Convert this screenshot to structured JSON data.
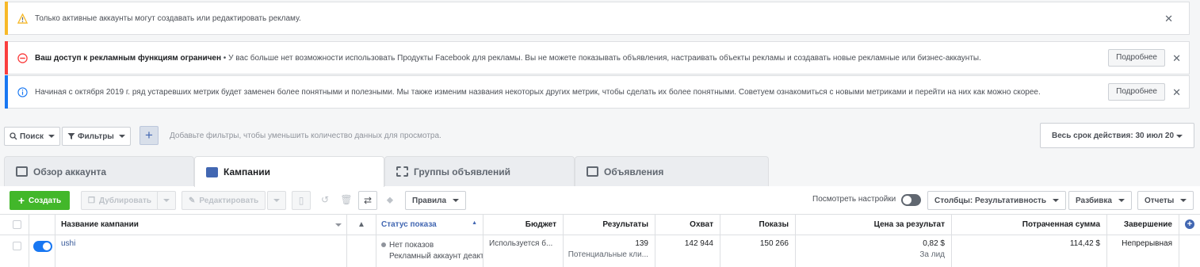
{
  "notices": {
    "inactive": {
      "text": "Только активные аккаунты могут создавать или редактировать рекламу."
    },
    "restricted": {
      "title": "Ваш доступ к рекламным функциям ограничен",
      "text": " • У вас больше нет возможности использовать Продукты Facebook для рекламы. Вы не можете показывать объявления, настраивать объекты рекламы и создавать новые рекламные или бизнес-аккаунты.",
      "button": "Подробнее"
    },
    "metrics": {
      "text": "Начиная с октября 2019 г. ряд устаревших метрик будет заменен более понятными и полезными. Мы также изменим названия некоторых других метрик, чтобы сделать их более понятными. Советуем ознакомиться с новыми метриками и перейти на них как можно скорее.",
      "button": "Подробнее"
    },
    "close": "✕"
  },
  "filterbar": {
    "search": "Поиск",
    "filters": "Фильтры",
    "hint": "Добавьте фильтры, чтобы уменьшить количество данных для просмотра.",
    "date_range": "Весь срок действия: 30 июл 20"
  },
  "tabs": [
    {
      "label": "Обзор аккаунта"
    },
    {
      "label": "Кампании"
    },
    {
      "label": "Группы объявлений"
    },
    {
      "label": "Объявления"
    }
  ],
  "toolbar": {
    "create": "Создать",
    "duplicate": "Дублировать",
    "edit": "Редактировать",
    "rules": "Правила",
    "view_settings": "Посмотреть настройки",
    "columns": "Столбцы: Результативность",
    "breakdown": "Разбивка",
    "reports": "Отчеты"
  },
  "table": {
    "headers": {
      "name": "Название кампании",
      "status": "Статус показа",
      "budget": "Бюджет",
      "results": "Результаты",
      "reach": "Охват",
      "impressions": "Показы",
      "cost": "Цена за результат",
      "spent": "Потраченная сумма",
      "end": "Завершение"
    },
    "row": {
      "name": "ushi",
      "status": "Нет показов",
      "status_sub": "Рекламный аккаунт деакти",
      "budget": "Используется б...",
      "results": "139",
      "results_sub": "Потенциальные кли...",
      "reach": "142 944",
      "impressions": "150 266",
      "cost": "0,82 $",
      "cost_sub": "За лид",
      "spent": "114,42 $",
      "end": "Непрерывная"
    }
  },
  "colors": {
    "accent": "#4267b2",
    "create": "#42b72a",
    "warning": "#f7b928",
    "error": "#fa3e3e",
    "info": "#1877f2"
  }
}
